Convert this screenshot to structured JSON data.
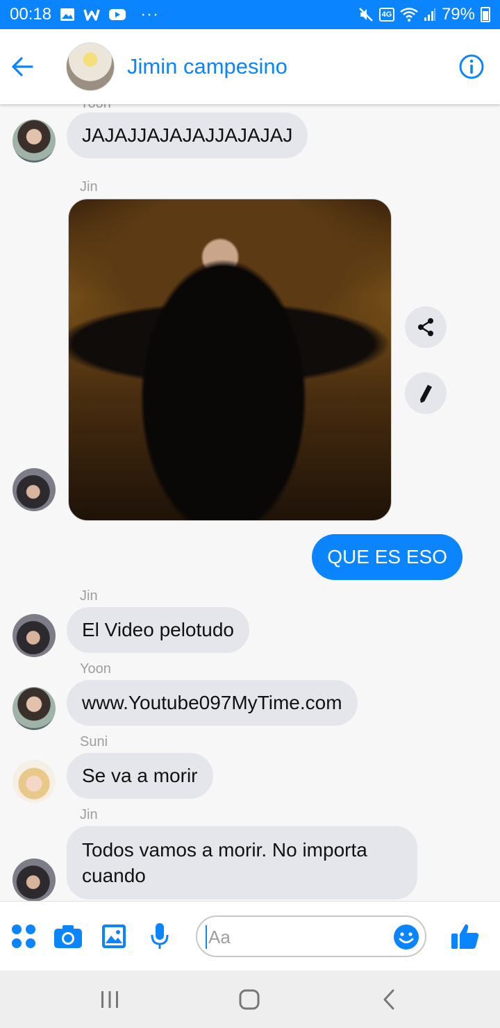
{
  "status_bar": {
    "time": "00:18",
    "notification_icons": [
      "gallery-icon",
      "w-app-icon",
      "youtube-icon"
    ],
    "more": "···",
    "volte": "Vo) 4G",
    "battery": "79%"
  },
  "header": {
    "contact_name": "Jimin campesino"
  },
  "messages": [
    {
      "sender": "Yoon",
      "text": "JAJAJJAJAJAJJAJAJAJ"
    },
    {
      "sender": "Jin",
      "type": "video"
    },
    {
      "sender": "me",
      "text": "QUE ES ESO"
    },
    {
      "sender": "Jin",
      "text": "El Video pelotudo"
    },
    {
      "sender": "Yoon",
      "text": "www.Youtube097MyTime.com"
    },
    {
      "sender": "Suni",
      "text": "Se va a morir"
    },
    {
      "sender": "Jin",
      "text": "Todos vamos a morir. No importa cuando"
    }
  ],
  "composer": {
    "placeholder": "Aa"
  },
  "colors": {
    "accent": "#0a84ff",
    "bubble_incoming": "#e4e6eb",
    "bubble_outgoing": "#0a84ff"
  }
}
